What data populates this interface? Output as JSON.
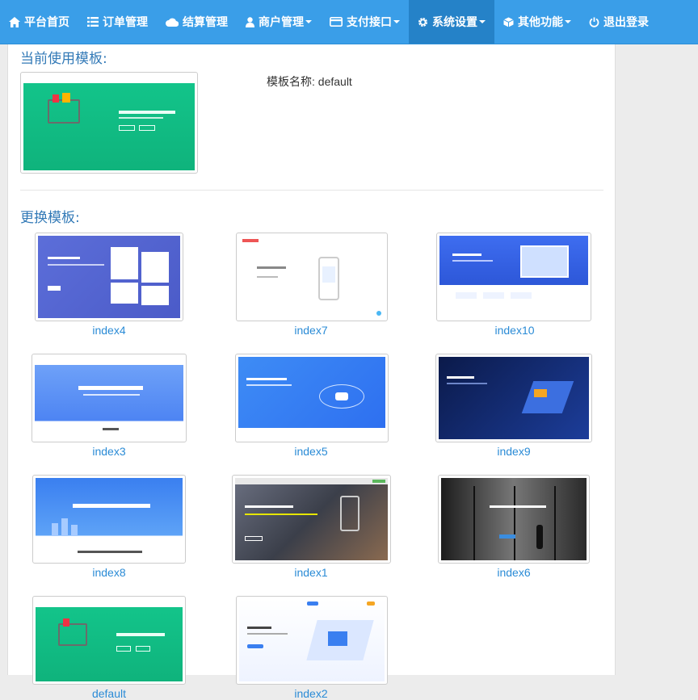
{
  "nav": {
    "items": [
      {
        "label": "平台首页",
        "icon": "home-icon",
        "dropdown": false
      },
      {
        "label": "订单管理",
        "icon": "list-icon",
        "dropdown": false
      },
      {
        "label": "结算管理",
        "icon": "cloud-icon",
        "dropdown": false
      },
      {
        "label": "商户管理",
        "icon": "user-icon",
        "dropdown": true
      },
      {
        "label": "支付接口",
        "icon": "credit-card-icon",
        "dropdown": true
      },
      {
        "label": "系统设置",
        "icon": "gear-icon",
        "dropdown": true,
        "active": true
      },
      {
        "label": "其他功能",
        "icon": "cube-icon",
        "dropdown": true
      },
      {
        "label": "退出登录",
        "icon": "power-icon",
        "dropdown": false
      }
    ]
  },
  "current": {
    "title": "当前使用模板:",
    "name_label": "模板名称: default"
  },
  "change": {
    "title": "更换模板:"
  },
  "templates": [
    "index4",
    "index7",
    "index10",
    "index3",
    "index5",
    "index9",
    "index8",
    "index1",
    "index6",
    "default",
    "index2"
  ],
  "colors": {
    "nav_bg": "#3a9ee8",
    "nav_active": "#2582c8",
    "link": "#2a8bd6",
    "title": "#337ab7"
  }
}
